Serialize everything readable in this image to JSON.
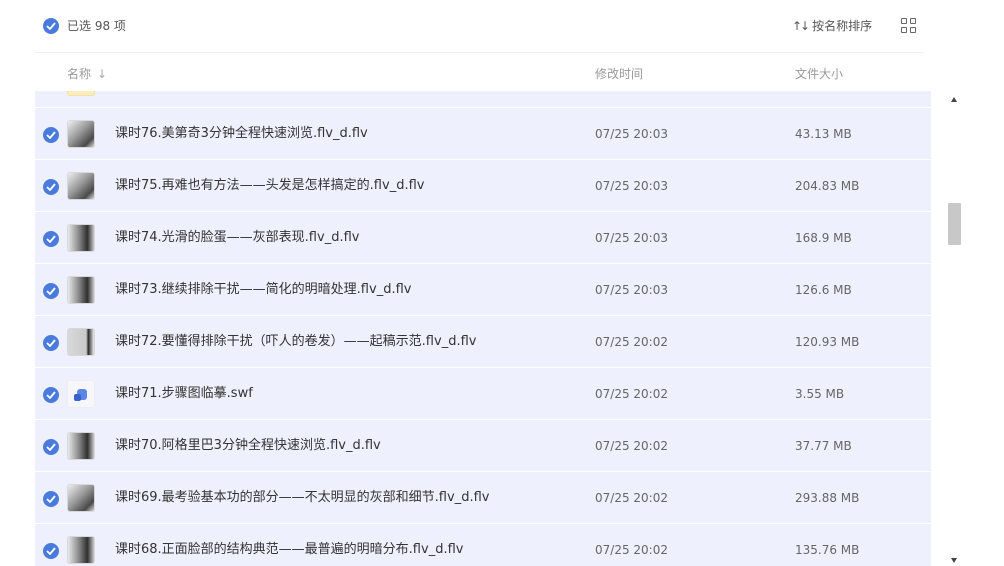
{
  "toolbar": {
    "selected_text": "已选 98 项",
    "sort_label": "按名称排序",
    "sort_icon": "↑↓"
  },
  "header": {
    "name_label": "名称",
    "name_arrow": "↓",
    "time_label": "修改时间",
    "size_label": "文件大小"
  },
  "files": [
    {
      "name": "",
      "time": "",
      "size": "",
      "thumb": "folder",
      "selected": true
    },
    {
      "name": "课时76.美第奇3分钟全程快速浏览.flv_d.flv",
      "time": "07/25 20:03",
      "size": "43.13 MB",
      "thumb": "vid",
      "selected": true
    },
    {
      "name": "课时75.再难也有方法——头发是怎样搞定的.flv_d.flv",
      "time": "07/25 20:03",
      "size": "204.83 MB",
      "thumb": "vid",
      "selected": true
    },
    {
      "name": "课时74.光滑的脸蛋——灰部表现.flv_d.flv",
      "time": "07/25 20:03",
      "size": "168.9 MB",
      "thumb": "vid2",
      "selected": true
    },
    {
      "name": "课时73.继续排除干扰——简化的明暗处理.flv_d.flv",
      "time": "07/25 20:03",
      "size": "126.6 MB",
      "thumb": "vid2",
      "selected": true
    },
    {
      "name": "课时72.要懂得排除干扰（吓人的卷发）——起稿示范.flv_d.flv",
      "time": "07/25 20:02",
      "size": "120.93 MB",
      "thumb": "vid3",
      "selected": true
    },
    {
      "name": "课时71.步骤图临摹.swf",
      "time": "07/25 20:02",
      "size": "3.55 MB",
      "thumb": "swf",
      "selected": true
    },
    {
      "name": "课时70.阿格里巴3分钟全程快速浏览.flv_d.flv",
      "time": "07/25 20:02",
      "size": "37.77 MB",
      "thumb": "vid2",
      "selected": true
    },
    {
      "name": "课时69.最考验基本功的部分——不太明显的灰部和细节.flv_d.flv",
      "time": "07/25 20:02",
      "size": "293.88 MB",
      "thumb": "vid",
      "selected": true
    },
    {
      "name": "课时68.正面脸部的结构典范——最普遍的明暗分布.flv_d.flv",
      "time": "07/25 20:02",
      "size": "135.76 MB",
      "thumb": "vid2",
      "selected": true
    }
  ],
  "colors": {
    "accent": "#4a7bdc",
    "row_selected_bg": "#eef0fd"
  }
}
